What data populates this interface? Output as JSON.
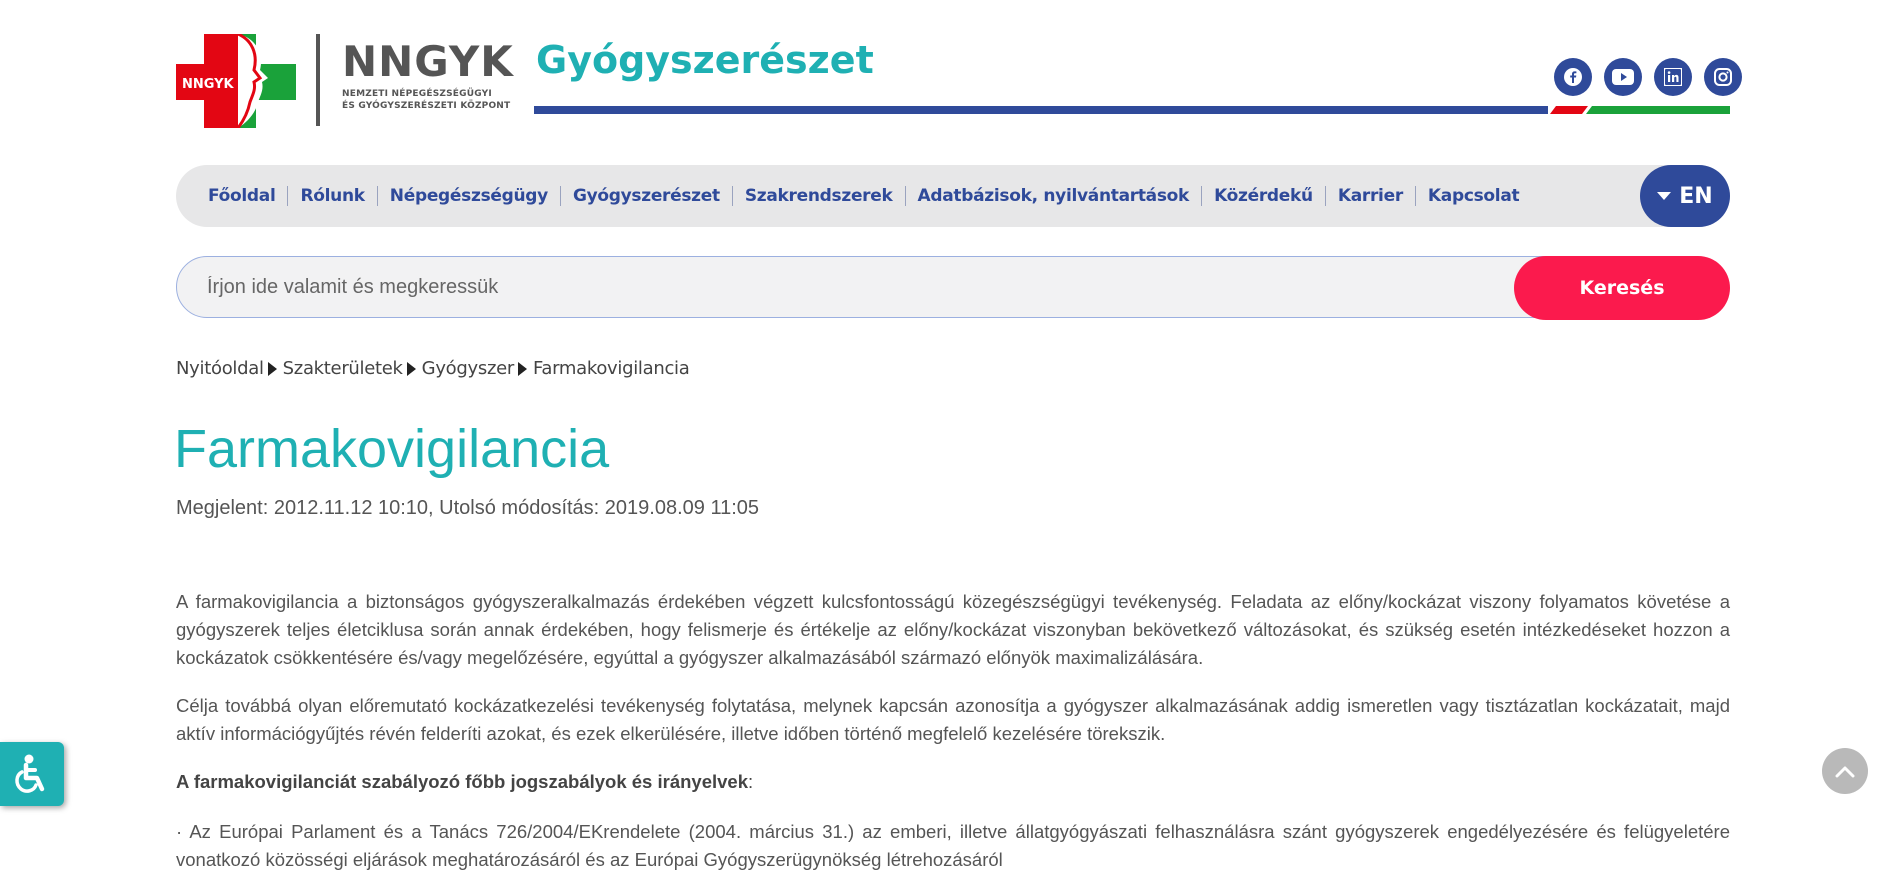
{
  "header": {
    "logo_badge": "NNGYK",
    "logo_title": "NNGYK",
    "logo_sub_line1": "NEMZETI NÉPEGÉSZSÉGÜGYI",
    "logo_sub_line2": "ÉS GYÓGYSZERÉSZETI KÖZPONT",
    "site_title": "Gyógyszerészet",
    "socials": [
      "facebook-icon",
      "youtube-icon",
      "linkedin-icon",
      "instagram-icon"
    ]
  },
  "nav": {
    "items": [
      "Főoldal",
      "Rólunk",
      "Népegészségügy",
      "Gyógyszerészet",
      "Szakrendszerek",
      "Adatbázisok, nyilvántartások",
      "Közérdekű",
      "Karrier",
      "Kapcsolat"
    ],
    "lang_label": "EN"
  },
  "search": {
    "placeholder": "Írjon ide valamit és megkeressük",
    "value": "",
    "button_label": "Keresés"
  },
  "breadcrumb": [
    "Nyitóoldal",
    "Szakterületek",
    "Gyógyszer",
    "Farmakovigilancia"
  ],
  "article": {
    "title": "Farmakovigilancia",
    "meta": "Megjelent: 2012.11.12 10:10, Utolsó módosítás: 2019.08.09 11:05",
    "p1": "A farmakovigilancia a biztonságos gyógyszeralkalmazás érdekében végzett kulcsfontosságú közegészségügyi tevékenység. Feladata az előny/kockázat viszony folyamatos követése a gyógyszerek teljes életciklusa során annak érdekében, hogy felismerje és értékelje az előny/kockázat viszonyban bekövetkező változásokat, és szükség esetén intézkedéseket hozzon a kockázatok csökkentésére és/vagy megelőzésére, egyúttal a gyógyszer alkalmazásából származó előnyök maximalizálására.",
    "p2": "Célja továbbá olyan előremutató kockázatkezelési tevékenység folytatása, melynek kapcsán azonosítja a gyógyszer alkalmazásának addig ismeretlen vagy tisztázatlan kockázatait, majd aktív információgyűjtés révén felderíti azokat, és ezek elkerülésére, illetve időben történő megfelelő kezelésére törekszik.",
    "p3_bold": "A farmakovigilanciát szabályozó főbb jogszabályok és irányelvek",
    "p3_colon": ":",
    "p4": "· Az Európai Parlament és a Tanács 726/2004/EKrendelete (2004. március 31.) az emberi, illetve állatgyógyászati felhasználásra szánt gyógyszerek engedélyezésére és felügyeletére vonatkozó közösségi eljárások meghatározásáról és az Európai Gyógyszerügynökség létrehozásáról"
  },
  "colors": {
    "teal": "#1fb0b3",
    "navy": "#2f4a9a",
    "search_red": "#fb1a4d",
    "logo_red": "#e30613",
    "logo_green": "#1aa23a"
  }
}
